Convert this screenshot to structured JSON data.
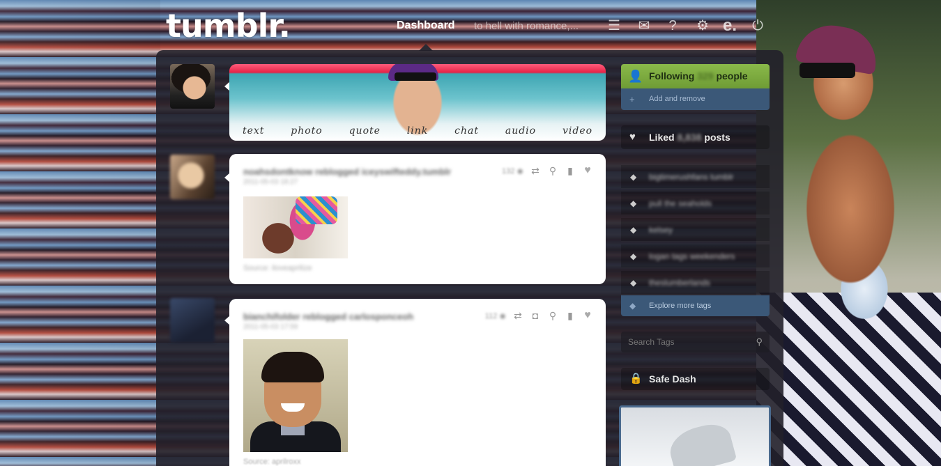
{
  "header": {
    "logo": "tumblr.",
    "nav_dashboard": "Dashboard",
    "nav_blog": "to hell with romance,..."
  },
  "nav_icons": [
    "list-icon",
    "mail-icon",
    "help-icon",
    "gear-icon",
    "edit-icon",
    "power-icon"
  ],
  "post_types": [
    "text",
    "photo",
    "quote",
    "link",
    "chat",
    "audio",
    "video"
  ],
  "posts": [
    {
      "user": "noahsdontknow reblogged iceyswifteddy.tumblr",
      "date": "2011-05-03 18:27",
      "source": "Source: iloveaprilize"
    },
    {
      "user": "bianchifolder reblogged carlosponceoh",
      "date": "2011-05-03 17:59",
      "source": "Source: aprilroxx"
    }
  ],
  "sidebar": {
    "following_prefix": "Following",
    "following_count": "329",
    "following_suffix": "people",
    "add_remove": "Add and remove",
    "liked_prefix": "Liked",
    "liked_count": "8,838",
    "liked_suffix": "posts",
    "tags": [
      "bigtimerushfans tumblr",
      "pull the seaholds",
      "kelsey",
      "logan tags weekenders",
      "theslumberlands"
    ],
    "explore": "Explore more tags",
    "search_placeholder": "Search Tags",
    "safe_dash": "Safe Dash"
  },
  "colors": {
    "following_green": "#7fb043",
    "sidebar_blue": "#3b5878"
  }
}
